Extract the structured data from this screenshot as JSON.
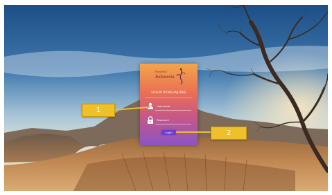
{
  "login_card": {
    "brand_small": "Wonderful",
    "brand_big": "Indonesia",
    "title": "LOGIN PENGUNJUNG",
    "username_placeholder": "Username",
    "password_placeholder": "Password",
    "login_label": "Login"
  },
  "callouts": {
    "first": "1",
    "second": "2"
  },
  "colors": {
    "callout": "#eec02a",
    "card_top": "#f3a54a",
    "card_bottom": "#8a55c4",
    "login_button": "#6f3fd0"
  },
  "icons": {
    "user": "user-icon",
    "lock": "lock-icon",
    "logo": "dancer-logo-icon"
  }
}
